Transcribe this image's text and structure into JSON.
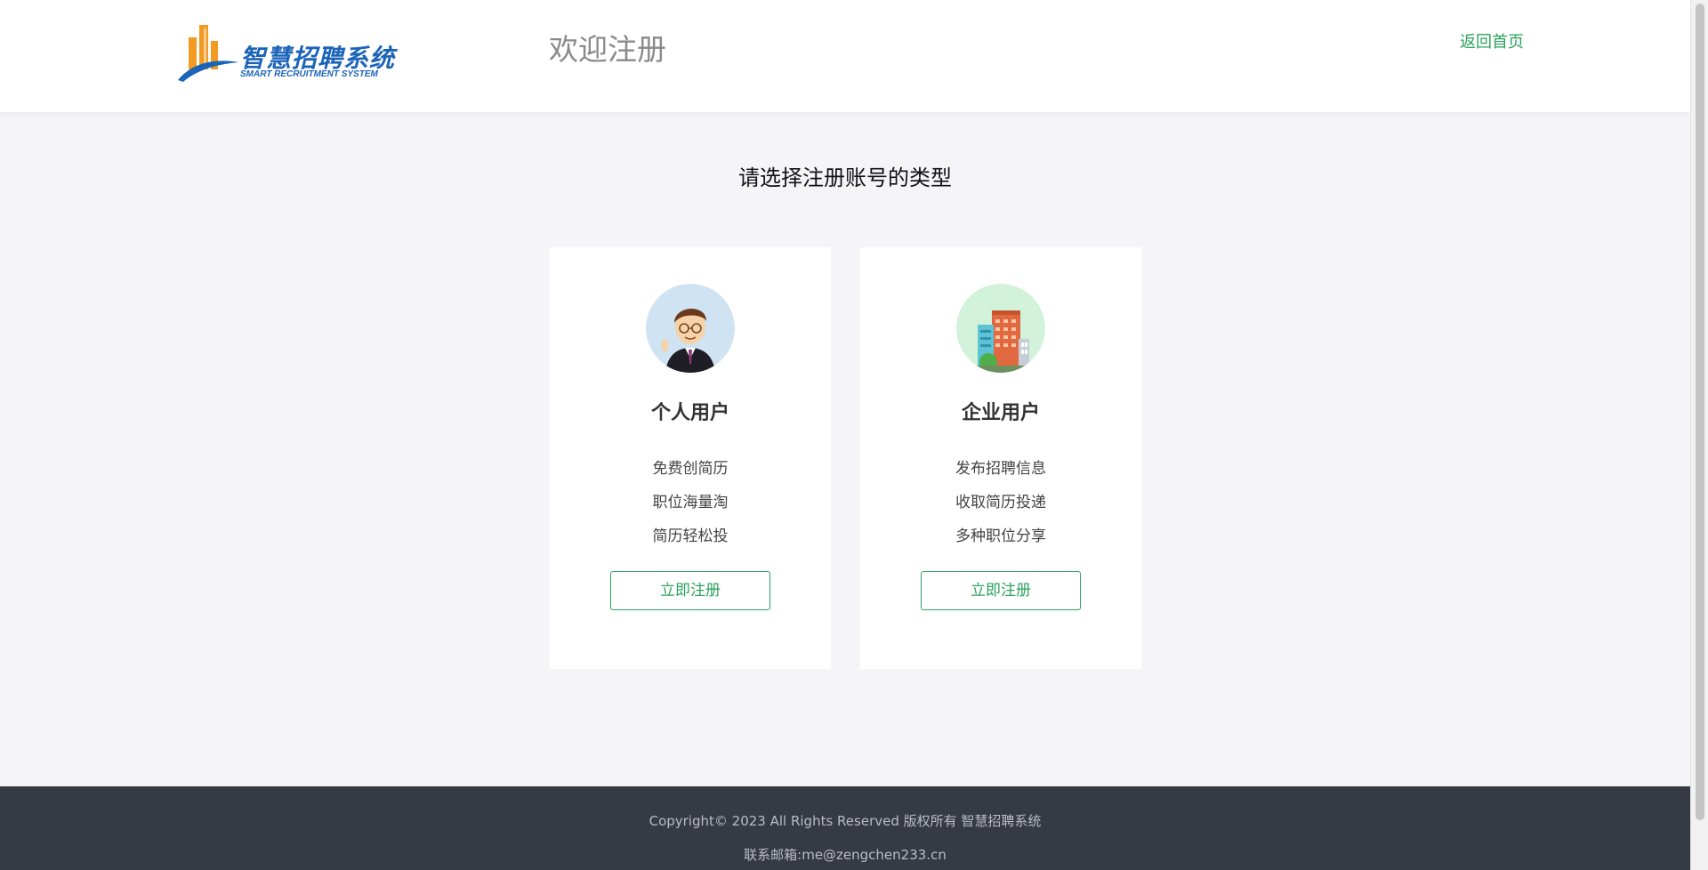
{
  "header": {
    "logo_cn": "智慧招聘系统",
    "logo_en": "SMART RECRUITMENT SYSTEM",
    "page_heading": "欢迎注册",
    "home_link": "返回首页"
  },
  "main": {
    "title": "请选择注册账号的类型",
    "cards": [
      {
        "title": "个人用户",
        "features": [
          "免费创简历",
          "职位海量淘",
          "简历轻松投"
        ],
        "button": "立即注册",
        "icon": "businessman-avatar-icon"
      },
      {
        "title": "企业用户",
        "features": [
          "发布招聘信息",
          "收取简历投递",
          "多种职位分享"
        ],
        "button": "立即注册",
        "icon": "office-building-icon"
      }
    ]
  },
  "footer": {
    "copyright": "Copyright© 2023 All Rights Reserved 版权所有 智慧招聘系统",
    "contact": "联系邮箱:me@zengchen233.cn"
  },
  "colors": {
    "accent": "#2aa25c",
    "footer_bg": "#363a45",
    "logo_blue": "#1c64b8",
    "logo_orange": "#f29a22"
  }
}
